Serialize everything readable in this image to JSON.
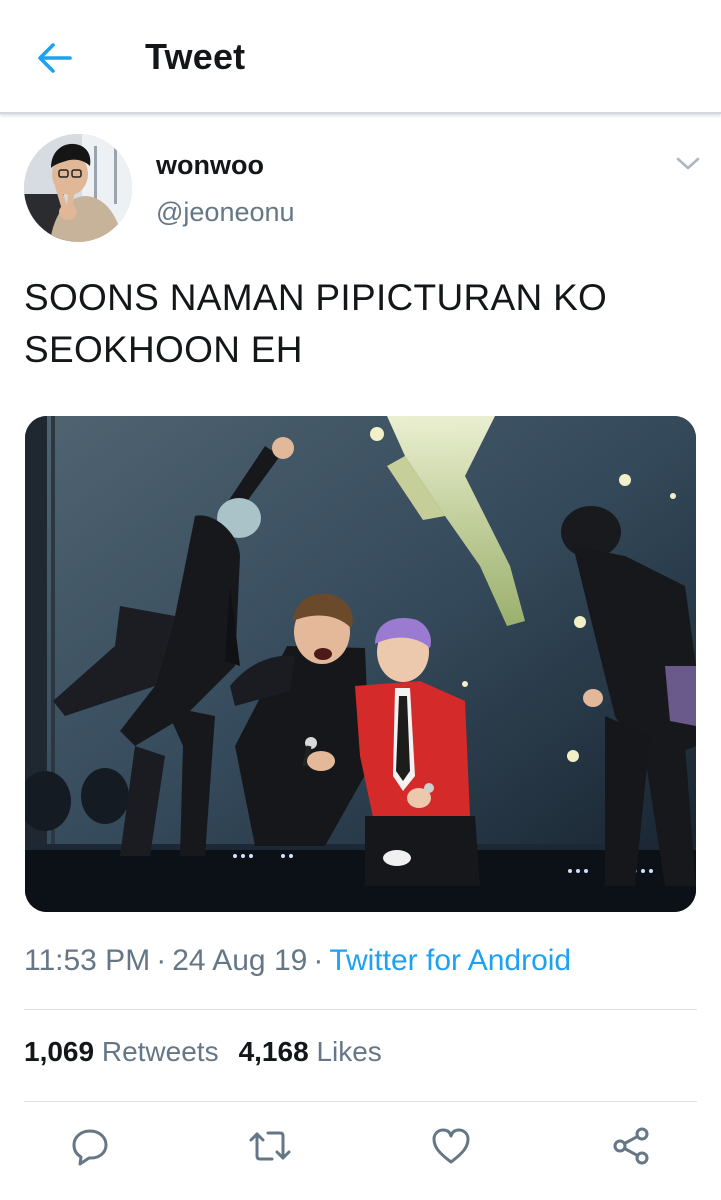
{
  "header": {
    "title": "Tweet",
    "back_icon": "arrow-left-icon",
    "accent": "#1da1f2"
  },
  "tweet": {
    "author": {
      "display_name": "wonwoo",
      "handle": "@jeoneonu"
    },
    "text": "SOONS NAMAN PIPICTURAN KO SEOKHOON EH",
    "time": "11:53 PM",
    "date": "24 Aug 19",
    "separator": "·",
    "source": "Twitter for Android",
    "stats": {
      "retweets_count": "1,069",
      "retweets_label": "Retweets",
      "likes_count": "4,168",
      "likes_label": "Likes"
    },
    "actions": [
      "reply-icon",
      "retweet-icon",
      "like-icon",
      "share-icon"
    ]
  },
  "colors": {
    "text_primary": "#14171a",
    "text_secondary": "#657786",
    "link": "#1da1f2"
  }
}
